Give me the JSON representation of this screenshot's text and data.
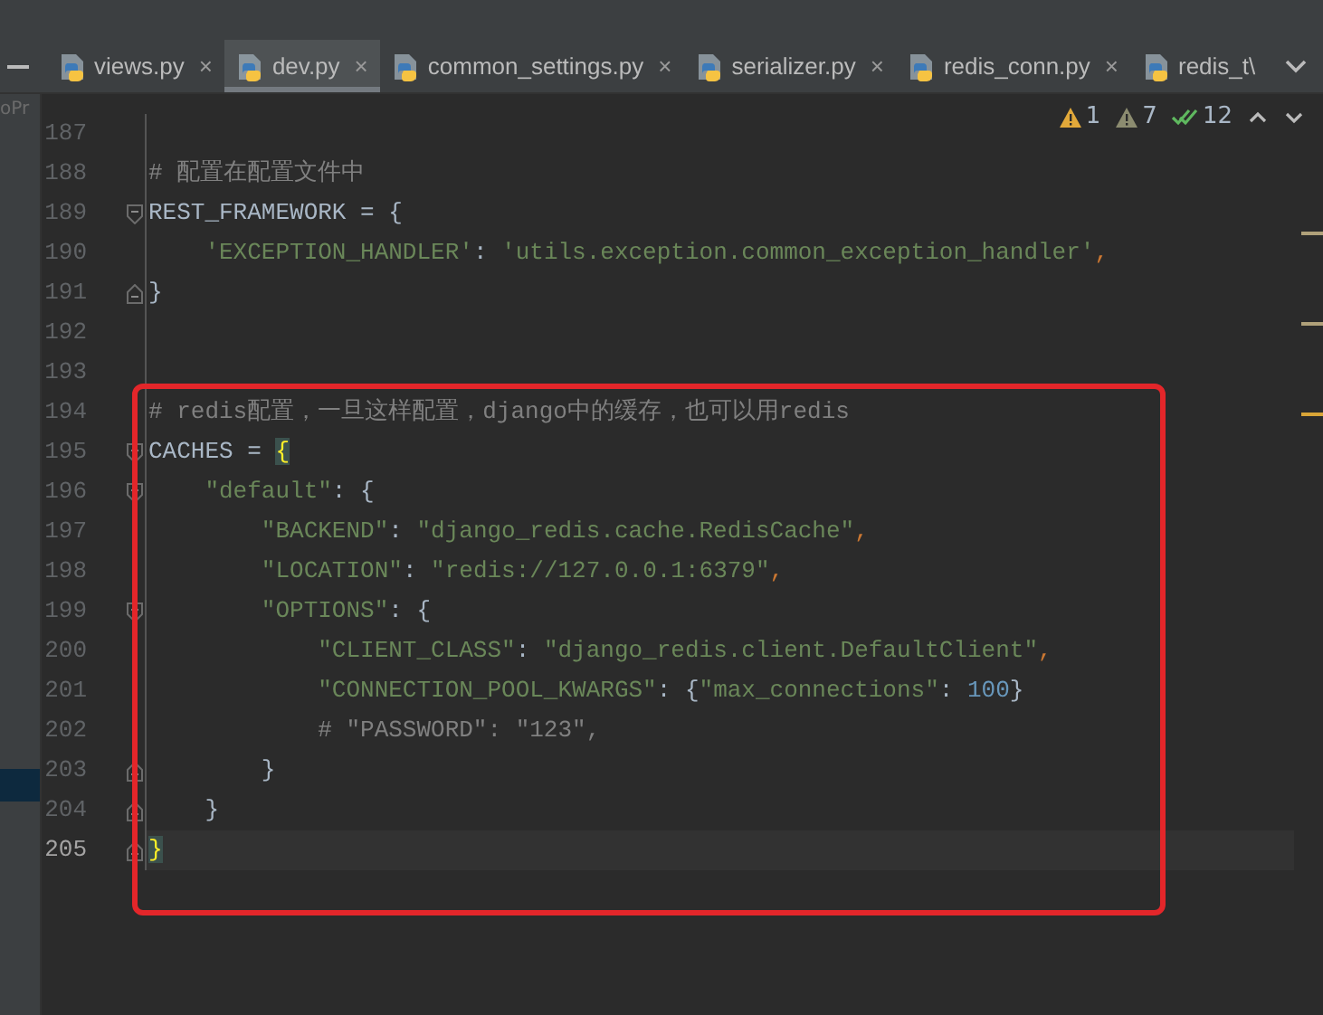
{
  "project_panel": {
    "label": "oPr"
  },
  "tabs": [
    {
      "label": "views.py",
      "selected": false,
      "close": "×"
    },
    {
      "label": "dev.py",
      "selected": true,
      "close": "×"
    },
    {
      "label": "common_settings.py",
      "selected": false,
      "close": "×"
    },
    {
      "label": "serializer.py",
      "selected": false,
      "close": "×"
    },
    {
      "label": "redis_conn.py",
      "selected": false,
      "close": "×"
    },
    {
      "label": "redis_t\\",
      "selected": false
    }
  ],
  "inspections": [
    {
      "kind": "warning",
      "count": "1"
    },
    {
      "kind": "weak_warning",
      "count": "7"
    },
    {
      "kind": "ok",
      "count": "12"
    }
  ],
  "lines": [
    {
      "number": "187",
      "current": false,
      "kind": "normal"
    },
    {
      "number": "188",
      "current": false,
      "kind": "normal",
      "tokens": [
        {
          "kind": "comment",
          "t": "# 配置在配置文件中"
        }
      ]
    },
    {
      "number": "189",
      "current": false,
      "kind": "fold_start",
      "tokens": [
        {
          "kind": "plain",
          "t": "REST_FRAMEWORK = {"
        }
      ]
    },
    {
      "number": "190",
      "current": false,
      "kind": "normal",
      "tokens": [
        {
          "kind": "string",
          "t": "    'EXCEPTION_HANDLER'"
        },
        {
          "kind": "plain",
          "t": ": "
        },
        {
          "kind": "string",
          "t": "'utils.exception.common_exception_handler'"
        },
        {
          "kind": "punct",
          "t": ","
        }
      ]
    },
    {
      "number": "191",
      "current": false,
      "kind": "fold_end",
      "tokens": [
        {
          "kind": "plain",
          "t": "}"
        }
      ]
    },
    {
      "number": "192",
      "current": false,
      "kind": "normal"
    },
    {
      "number": "193",
      "current": false,
      "kind": "normal"
    },
    {
      "number": "194",
      "current": false,
      "kind": "normal",
      "tokens": [
        {
          "kind": "comment",
          "t": "# redis配置，一旦这样配置，django中的缓存，也可以用redis"
        }
      ]
    },
    {
      "number": "195",
      "current": false,
      "kind": "fold_start",
      "tokens": [
        {
          "kind": "plain",
          "t": "CACHES = "
        },
        {
          "kind": "brace_match",
          "t": "{"
        }
      ]
    },
    {
      "number": "196",
      "current": false,
      "kind": "fold_start",
      "tokens": [
        {
          "kind": "string",
          "t": "    \"default\""
        },
        {
          "kind": "plain",
          "t": ": {"
        }
      ]
    },
    {
      "number": "197",
      "current": false,
      "kind": "normal",
      "tokens": [
        {
          "kind": "string",
          "t": "        \"BACKEND\""
        },
        {
          "kind": "plain",
          "t": ": "
        },
        {
          "kind": "string",
          "t": "\"django_redis.cache.RedisCache\""
        },
        {
          "kind": "punct",
          "t": ","
        }
      ]
    },
    {
      "number": "198",
      "current": false,
      "kind": "normal",
      "tokens": [
        {
          "kind": "string",
          "t": "        \"LOCATION\""
        },
        {
          "kind": "plain",
          "t": ": "
        },
        {
          "kind": "string",
          "t": "\"redis://127.0.0.1:6379\""
        },
        {
          "kind": "punct",
          "t": ","
        }
      ]
    },
    {
      "number": "199",
      "current": false,
      "kind": "fold_start",
      "tokens": [
        {
          "kind": "string",
          "t": "        \"OPTIONS\""
        },
        {
          "kind": "plain",
          "t": ": {"
        }
      ]
    },
    {
      "number": "200",
      "current": false,
      "kind": "normal",
      "tokens": [
        {
          "kind": "string",
          "t": "            \"CLIENT_CLASS\""
        },
        {
          "kind": "plain",
          "t": ": "
        },
        {
          "kind": "string",
          "t": "\"django_redis.client.DefaultClient\""
        },
        {
          "kind": "punct",
          "t": ","
        }
      ]
    },
    {
      "number": "201",
      "current": false,
      "kind": "normal",
      "tokens": [
        {
          "kind": "string",
          "t": "            \"CONNECTION_POOL_KWARGS\""
        },
        {
          "kind": "plain",
          "t": ": {"
        },
        {
          "kind": "string",
          "t": "\"max_connections\""
        },
        {
          "kind": "plain",
          "t": ": "
        },
        {
          "kind": "number",
          "t": "100"
        },
        {
          "kind": "plain",
          "t": "}"
        }
      ]
    },
    {
      "number": "202",
      "current": false,
      "kind": "normal",
      "tokens": [
        {
          "kind": "comment",
          "t": "            # \"PASSWORD\": \"123\","
        }
      ]
    },
    {
      "number": "203",
      "current": false,
      "kind": "fold_end",
      "tokens": [
        {
          "kind": "plain",
          "t": "        }"
        }
      ]
    },
    {
      "number": "204",
      "current": false,
      "kind": "fold_end",
      "tokens": [
        {
          "kind": "plain",
          "t": "    }"
        }
      ]
    },
    {
      "number": "205",
      "current": true,
      "kind": "fold_end",
      "tokens": [
        {
          "kind": "brace_match",
          "t": "}"
        }
      ]
    }
  ]
}
